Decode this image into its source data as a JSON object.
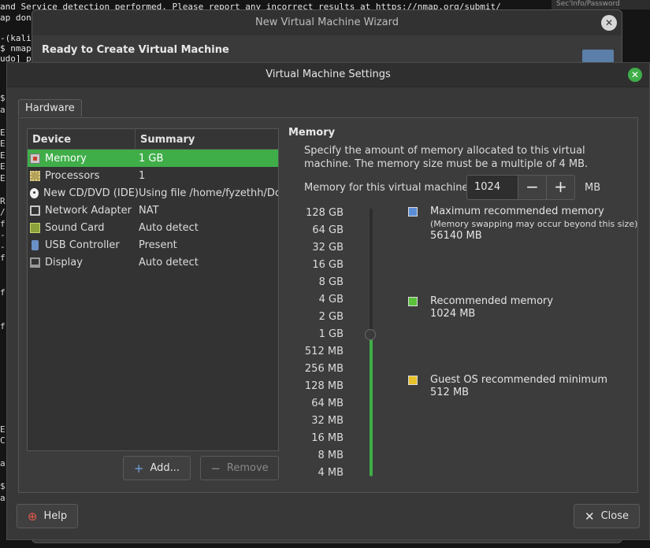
{
  "terminal": {
    "line1": "and Service detection performed. Please report any incorrect results at https://nmap.org/submit/",
    "line2": "ap done",
    "line3": "-(kali",
    "line4": "$ nmap",
    "line5": "udo] pa",
    "edge_chars": [
      "$",
      "a",
      "",
      "E",
      "E",
      "E",
      "E",
      "E",
      "",
      "R",
      "/",
      "f",
      "-",
      "-",
      "f",
      "",
      "",
      "f",
      "",
      "",
      "f",
      "",
      "",
      "",
      "",
      "",
      "",
      "",
      "",
      "E",
      "C",
      "",
      "a",
      "",
      "$",
      "a"
    ],
    "sec_tab": "Sec'Info/Password"
  },
  "wizard": {
    "title": "New Virtual Machine Wizard",
    "heading": "Ready to Create Virtual Machine",
    "close_icon": "close-icon"
  },
  "dialog": {
    "title": "Virtual Machine Settings",
    "close_icon": "close-icon",
    "accent_color": "#3fae49"
  },
  "tabs": {
    "hardware": "Hardware"
  },
  "device_list": {
    "col_device": "Device",
    "col_summary": "Summary",
    "rows": [
      {
        "device": "Memory",
        "summary": "1 GB",
        "icon": "memory-icon",
        "selected": true
      },
      {
        "device": "Processors",
        "summary": "1",
        "icon": "processor-icon"
      },
      {
        "device": "New CD/DVD (IDE)",
        "summary": "Using file /home/fyzethh/Doc",
        "icon": "cd-dvd-icon"
      },
      {
        "device": "Network Adapter",
        "summary": "NAT",
        "icon": "network-adapter-icon"
      },
      {
        "device": "Sound Card",
        "summary": "Auto detect",
        "icon": "sound-card-icon"
      },
      {
        "device": "USB Controller",
        "summary": "Present",
        "icon": "usb-icon"
      },
      {
        "device": "Display",
        "summary": "Auto detect",
        "icon": "display-icon"
      }
    ]
  },
  "buttons": {
    "add": "Add...",
    "remove": "Remove",
    "help": "Help",
    "close": "Close"
  },
  "memory": {
    "title": "Memory",
    "description": "Specify the amount of memory allocated to this virtual machine. The memory size must be a multiple of 4 MB.",
    "field_label": "Memory for this virtual machine:",
    "value": "1024",
    "unit": "MB",
    "minus": "−",
    "plus": "+",
    "scale": [
      "128 GB",
      "64 GB",
      "32 GB",
      "16 GB",
      "8 GB",
      "4 GB",
      "2 GB",
      "1 GB",
      "512 MB",
      "256 MB",
      "128 MB",
      "64 MB",
      "32 MB",
      "16 MB",
      "8 MB",
      "4 MB"
    ],
    "slider_selected_label": "1 GB",
    "legend": {
      "max": {
        "label": "Maximum recommended memory",
        "note": "(Memory swapping may occur beyond this size)",
        "value": "56140 MB",
        "color": "#5b8ed6"
      },
      "recommended": {
        "label": "Recommended memory",
        "value": "1024 MB",
        "color": "#5ac23a"
      },
      "guest_min": {
        "label": "Guest OS recommended minimum",
        "value": "512 MB",
        "color": "#e8c22a"
      }
    }
  }
}
